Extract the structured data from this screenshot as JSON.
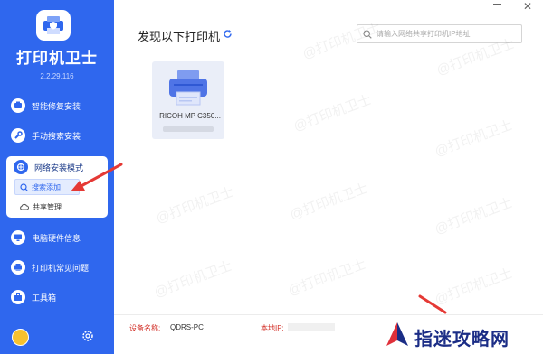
{
  "app": {
    "title": "打印机卫士",
    "version": "2.2.29.116"
  },
  "sidebar": {
    "items": [
      {
        "label": "智能修复安装"
      },
      {
        "label": "手动搜索安装"
      },
      {
        "label": "网络安装模式"
      },
      {
        "label": "电脑硬件信息"
      },
      {
        "label": "打印机常见问题"
      },
      {
        "label": "工具箱"
      }
    ],
    "sub_items": [
      {
        "label": "搜索添加"
      },
      {
        "label": "共享管理"
      }
    ]
  },
  "main": {
    "heading": "发现以下打印机",
    "search_placeholder": "请输入网络共享打印机IP地址",
    "printers": [
      {
        "name": "RICOH MP C350..."
      }
    ]
  },
  "footer": {
    "device_label": "设备名称:",
    "device_value": "QDRS-PC",
    "ip_label": "本地IP:"
  },
  "watermark": {
    "text": "@打印机卫士"
  },
  "site_mark": {
    "text": "指迷攻略网"
  },
  "colors": {
    "primary": "#2f67ee",
    "arrow": "#e53935",
    "label_red": "#d3322a"
  }
}
